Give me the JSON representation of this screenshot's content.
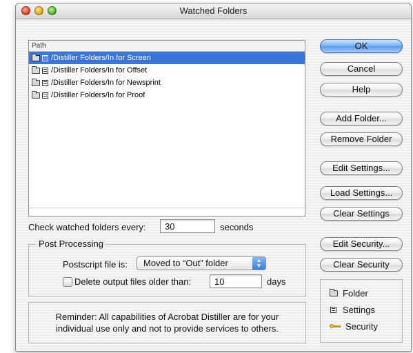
{
  "window": {
    "title": "Watched Folders"
  },
  "list": {
    "header": "Path",
    "items": [
      {
        "label": "/Distiller Folders/In for Screen",
        "selected": true
      },
      {
        "label": "/Distiller Folders/In for Offset",
        "selected": false
      },
      {
        "label": "/Distiller Folders/In for Newsprint",
        "selected": false
      },
      {
        "label": "/Distiller Folders/In for Proof",
        "selected": false
      }
    ]
  },
  "buttons": {
    "ok": "OK",
    "cancel": "Cancel",
    "help": "Help",
    "add_folder": "Add Folder...",
    "remove_folder": "Remove Folder",
    "edit_settings": "Edit Settings...",
    "load_settings": "Load Settings...",
    "clear_settings": "Clear Settings",
    "edit_security": "Edit Security...",
    "clear_security": "Clear Security"
  },
  "check_interval": {
    "label": "Check watched folders every:",
    "value": "30",
    "unit": "seconds"
  },
  "post_processing": {
    "title": "Post Processing",
    "postscript_label": "Postscript file is:",
    "postscript_value": "Moved to “Out” folder",
    "delete_label": "Delete output files older than:",
    "delete_value": "10",
    "delete_unit": "days",
    "delete_checked": false
  },
  "reminder": {
    "line1": "Reminder: All capabilities of Acrobat Distiller are for your",
    "line2": "individual use only and not to provide services to others."
  },
  "legend": {
    "folder": "Folder",
    "settings": "Settings",
    "security": "Security"
  },
  "colors": {
    "selection": "#3875d7",
    "default_button": "#5c9ae8",
    "key": "#c9960c"
  }
}
